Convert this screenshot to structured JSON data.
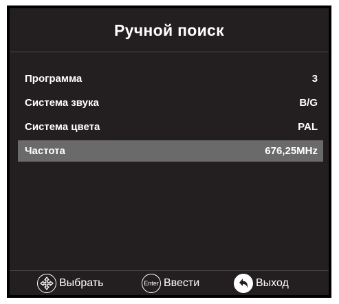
{
  "title": "Ручной поиск",
  "rows": [
    {
      "label": "Программа",
      "value": "3"
    },
    {
      "label": "Система звука",
      "value": "B/G"
    },
    {
      "label": "Система цвета",
      "value": "PAL"
    },
    {
      "label": "Частота",
      "value": "676,25MHz"
    }
  ],
  "footer": {
    "select_label": "Выбрать",
    "enter_icon_text": "Enter",
    "enter_label": "Ввести",
    "exit_label": "Выход"
  },
  "colors": {
    "panel_bg": "#231f20",
    "selected_row_bg": "#6b6a6a",
    "text": "#ffffff"
  }
}
